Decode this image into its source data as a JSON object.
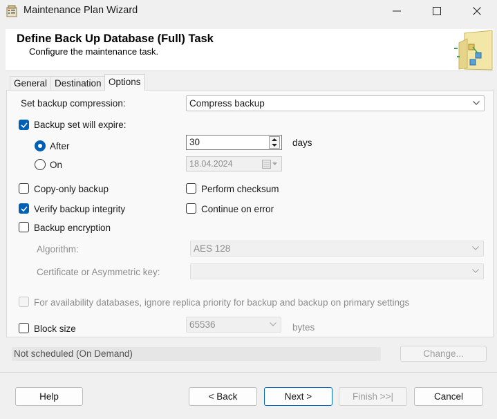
{
  "window": {
    "title": "Maintenance Plan Wizard"
  },
  "header": {
    "title": "Define Back Up Database (Full) Task",
    "subtitle": "Configure the maintenance task."
  },
  "tabs": [
    {
      "label": "General",
      "active": false
    },
    {
      "label": "Destination",
      "active": false
    },
    {
      "label": "Options",
      "active": true
    }
  ],
  "options": {
    "compression_label": "Set backup compression:",
    "compression_value": "Compress backup",
    "expire_label": "Backup set will expire:",
    "expire_checked": true,
    "after_label": "After",
    "after_selected": true,
    "after_value": "30",
    "days_label": "days",
    "on_label": "On",
    "on_date": "18.04.2024",
    "copy_only_label": "Copy-only backup",
    "copy_only_checked": false,
    "perform_checksum_label": "Perform checksum",
    "perform_checksum_checked": false,
    "verify_label": "Verify backup integrity",
    "verify_checked": true,
    "continue_label": "Continue on error",
    "continue_checked": false,
    "encryption_label": "Backup encryption",
    "encryption_checked": false,
    "algorithm_label": "Algorithm:",
    "algorithm_value": "AES 128",
    "certificate_label": "Certificate or Asymmetric key:",
    "certificate_value": "",
    "availability_label": "For availability databases, ignore replica priority for backup and backup on primary settings",
    "block_size_label": "Block size",
    "block_size_value": "65536",
    "bytes_label": "bytes"
  },
  "schedule": {
    "status": "Not scheduled (On Demand)",
    "change_label": "Change..."
  },
  "buttons": {
    "help": "Help",
    "back": "< Back",
    "next": "Next >",
    "finish": "Finish >>|",
    "cancel": "Cancel"
  },
  "colors": {
    "accent": "#0060b8",
    "primary_border": "#0067c0"
  }
}
